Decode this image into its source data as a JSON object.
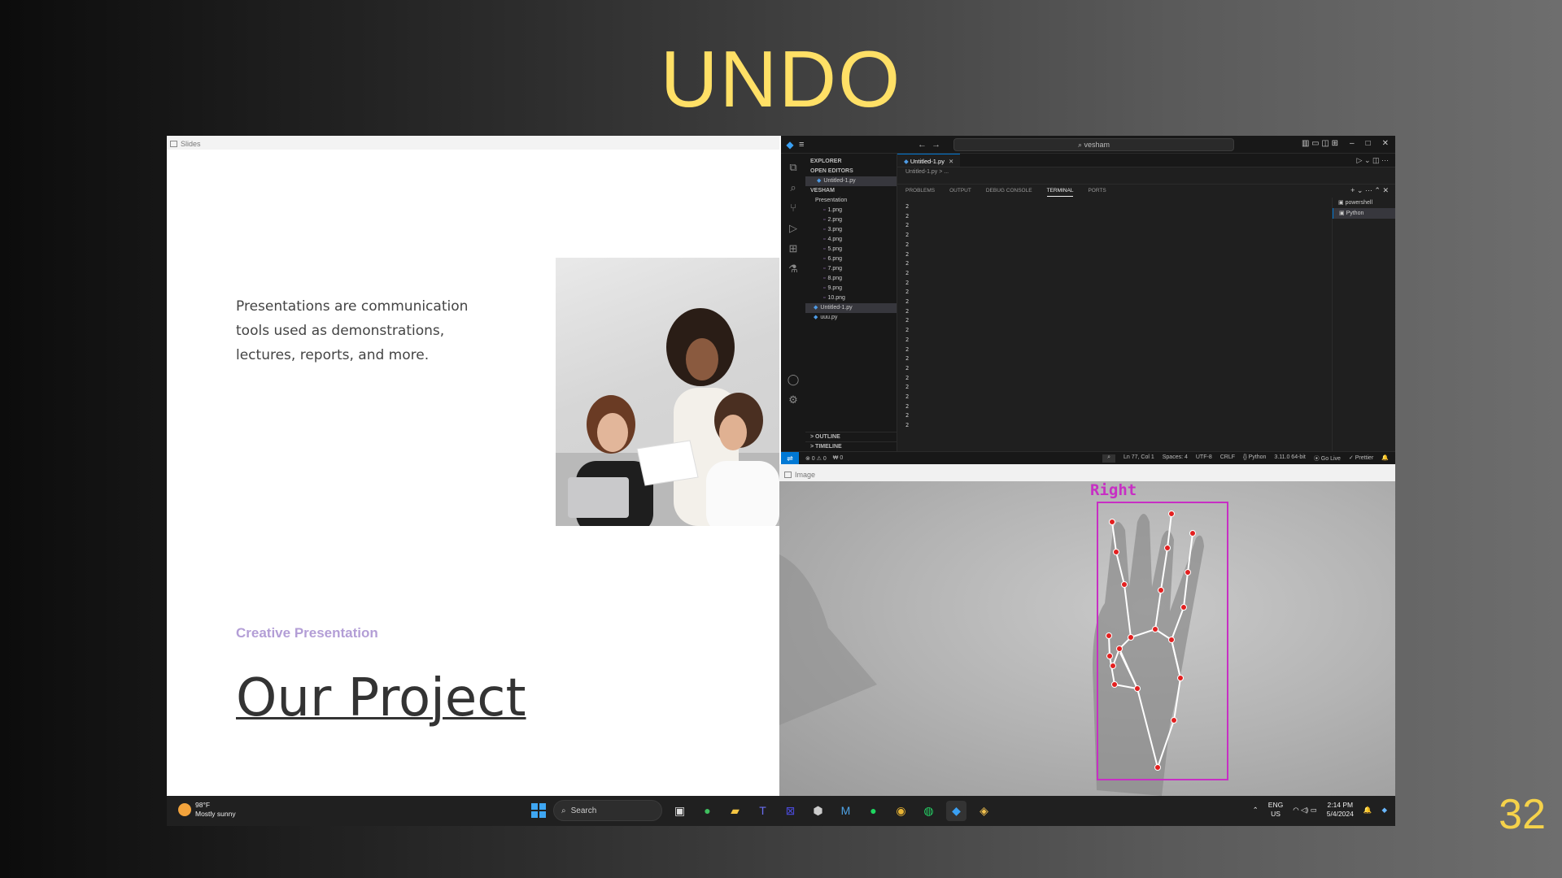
{
  "slide": {
    "title": "UNDO",
    "number": "32"
  },
  "slides_window": {
    "window_title": "Slides",
    "body_text": "Presentations are communication tools used as demonstrations, lectures, reports, and more.",
    "subtitle": "Creative Presentation",
    "heading": "Our Project"
  },
  "vscode": {
    "search_text": "vesham",
    "explorer": {
      "title": "EXPLORER",
      "open_editors_label": "OPEN EDITORS",
      "open_editor_file": "Untitled-1.py",
      "workspace_label": "VESHAM",
      "folder_label": "Presentation",
      "files": [
        "1.png",
        "2.png",
        "3.png",
        "4.png",
        "5.png",
        "6.png",
        "7.png",
        "8.png",
        "9.png",
        "10.png"
      ],
      "py_files": [
        "Untitled-1.py",
        "uuu.py"
      ],
      "outline_label": "OUTLINE",
      "timeline_label": "TIMELINE"
    },
    "tab_label": "Untitled-1.py",
    "breadcrumb": "Untitled-1.py > ...",
    "panel_tabs": [
      "PROBLEMS",
      "OUTPUT",
      "DEBUG CONSOLE",
      "TERMINAL",
      "PORTS"
    ],
    "terminal_lines": [
      "2",
      "2",
      "2",
      "2",
      "2",
      "2",
      "2",
      "2",
      "2",
      "2",
      "2",
      "2",
      "2",
      "2",
      "2",
      "2",
      "2",
      "2",
      "2",
      "2",
      "2",
      "2",
      "2",
      "2"
    ],
    "terminals": [
      "powershell",
      "Python"
    ],
    "status": {
      "problems": "⊗ 0 ⚠ 0",
      "ports": "₩ 0",
      "position": "Ln 77, Col 1",
      "spaces": "Spaces: 4",
      "encoding": "UTF-8",
      "eol": "CRLF",
      "language": "Python",
      "interpreter": "3.11.0 64-bit",
      "golive": "Go Live",
      "prettier": "Prettier"
    }
  },
  "camera_window": {
    "window_title": "Image",
    "hand_label": "Right"
  },
  "taskbar": {
    "weather_temp": "98°F",
    "weather_desc": "Mostly sunny",
    "search_label": "Search",
    "lang_line1": "ENG",
    "lang_line2": "US",
    "time": "2:14 PM",
    "date": "5/4/2024"
  }
}
